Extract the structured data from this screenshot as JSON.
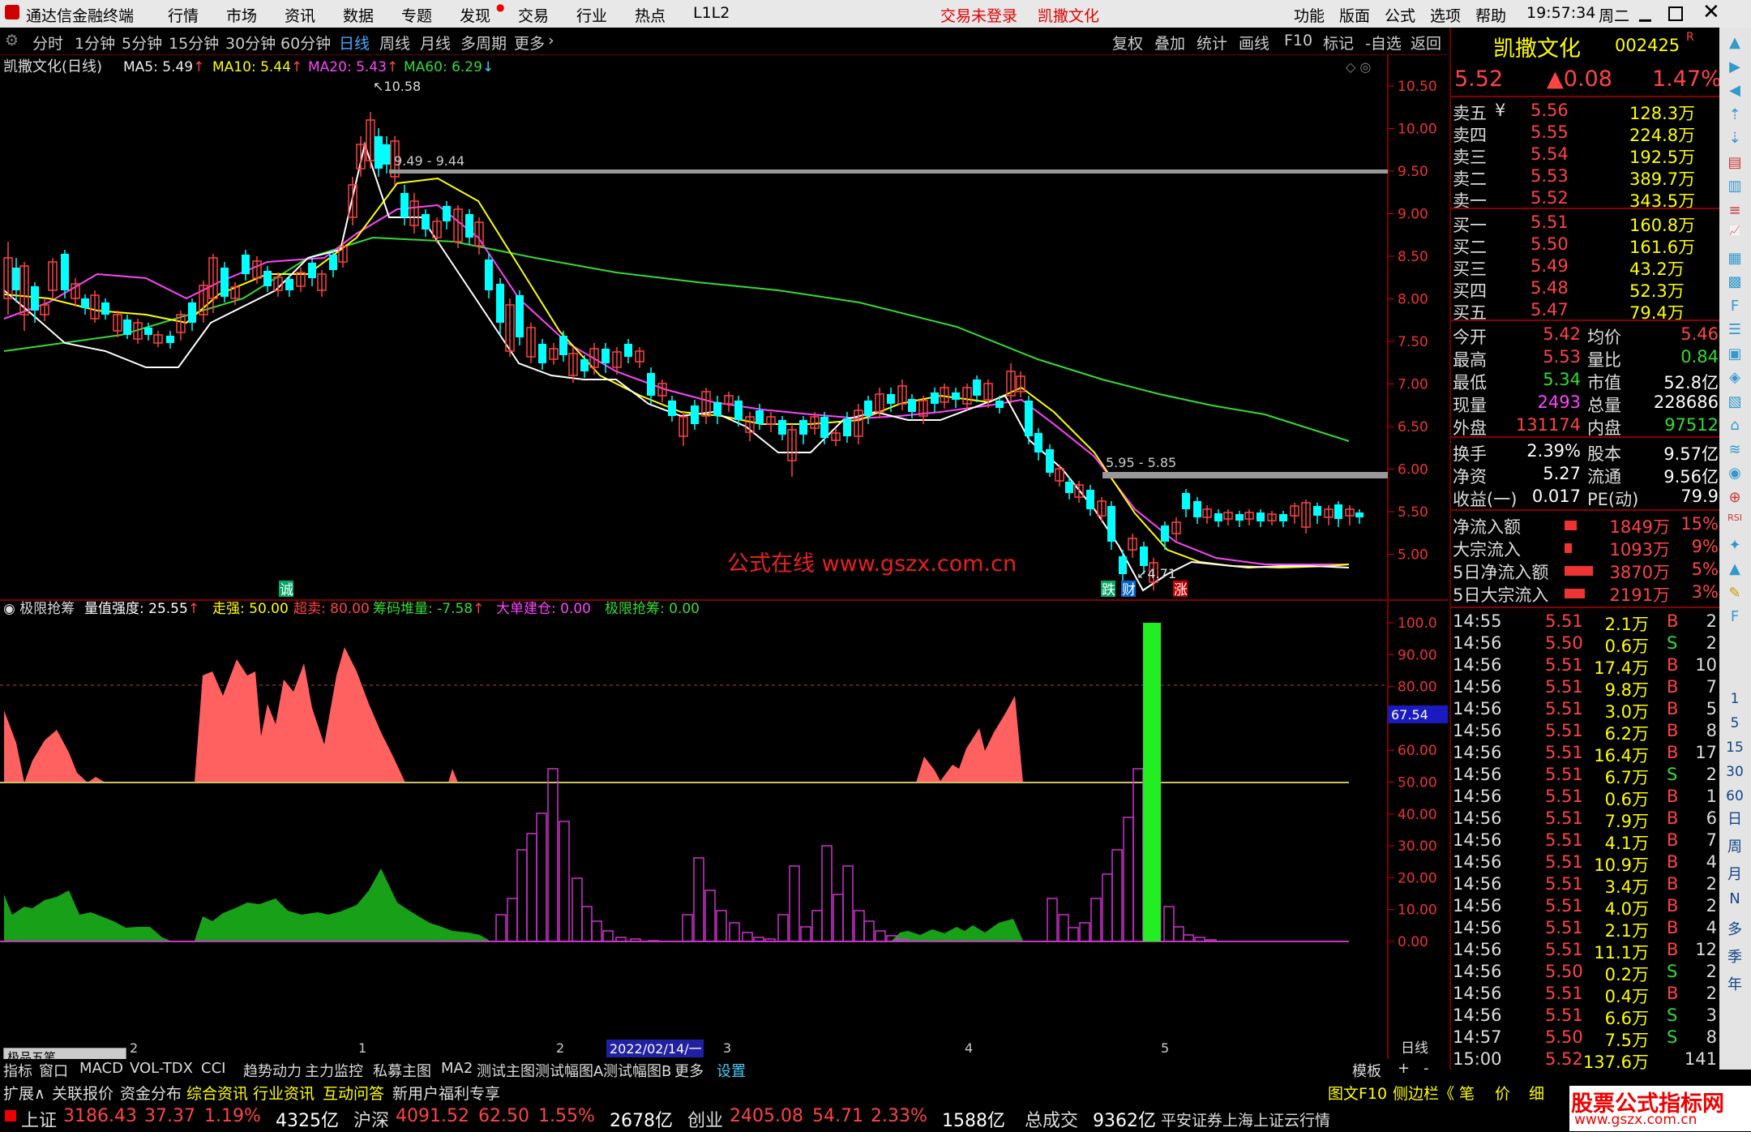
{
  "app": {
    "title": "通达信金融终端",
    "menu": [
      "行情",
      "市场",
      "资讯",
      "数据",
      "专题",
      "发现",
      "交易",
      "行业",
      "热点",
      "L1L2"
    ],
    "login_status": "交易未登录",
    "stock_name_top": "凯撒文化",
    "right_menu": [
      "功能",
      "版面",
      "公式",
      "选项",
      "帮助"
    ],
    "clock": "19:57:34",
    "weekday": "周二"
  },
  "period_bar": {
    "items": [
      "分时",
      "1分钟",
      "5分钟",
      "15分钟",
      "30分钟",
      "60分钟",
      "日线",
      "周线",
      "月线",
      "多周期",
      "更多"
    ],
    "selected": "日线",
    "tools": [
      "复权",
      "叠加",
      "统计",
      "画线",
      "F10",
      "标记",
      "-自选",
      "返回"
    ]
  },
  "main_chart": {
    "label": "凯撒文化(日线)",
    "ma": [
      {
        "name": "MA5",
        "value": "5.49",
        "arrow": "↑",
        "color": "#ffffff"
      },
      {
        "name": "MA10",
        "value": "5.44",
        "arrow": "↑",
        "color": "#ffff00"
      },
      {
        "name": "MA20",
        "value": "5.43",
        "arrow": "↑",
        "color": "#ff44ff"
      },
      {
        "name": "MA60",
        "value": "6.29",
        "arrow": "↓",
        "color": "#33dd33"
      }
    ],
    "y_ticks": [
      "10.50",
      "10.00",
      "9.50",
      "9.00",
      "8.50",
      "8.00",
      "7.50",
      "7.00",
      "6.50",
      "6.00",
      "5.50",
      "5.00"
    ],
    "annotations": {
      "high": "10.58",
      "low": "4.71",
      "band1": "9.49 - 9.44",
      "band2": "5.95 - 5.85"
    },
    "watermark": "公式在线  www.gszx.com.cn",
    "markers": [
      "诚",
      "跌",
      "财",
      "涨"
    ]
  },
  "indicator": {
    "name": "极限抢筹",
    "items": [
      {
        "label": "量值强度:",
        "value": "25.55",
        "arrow": "↑",
        "color": "#ffffff"
      },
      {
        "label": "走强:",
        "value": "50.00",
        "color": "#ffff00"
      },
      {
        "label": "超卖:",
        "value": "80.00",
        "color": "#ff4444"
      },
      {
        "label": "筹码堆量:",
        "value": "-7.58",
        "arrow": "↑",
        "color": "#33dd33"
      },
      {
        "label": "大单建仓:",
        "value": "0.00",
        "color": "#ff44ff"
      },
      {
        "label": "极限抢筹:",
        "value": "0.00",
        "color": "#33dd33"
      }
    ],
    "y_ticks": [
      "100.0",
      "90.00",
      "80.00",
      "70.00",
      "60.00",
      "50.00",
      "40.00",
      "30.00",
      "20.00",
      "10.00",
      "0.00"
    ],
    "current_value": "67.54"
  },
  "x_axis": {
    "labels": [
      "2",
      "1",
      "2",
      "3",
      "4",
      "5"
    ],
    "cursor_date": "2022/02/14/一",
    "period": "日线"
  },
  "quote": {
    "name": "凯撒文化",
    "code": "002425",
    "flag": "R",
    "price": "5.52",
    "change": "▲0.08",
    "pct": "1.47%",
    "asks": [
      {
        "label": "卖五",
        "mark": "¥",
        "price": "5.56",
        "vol": "128.3万"
      },
      {
        "label": "卖四",
        "price": "5.55",
        "vol": "224.8万"
      },
      {
        "label": "卖三",
        "price": "5.54",
        "vol": "192.5万"
      },
      {
        "label": "卖二",
        "price": "5.53",
        "vol": "389.7万"
      },
      {
        "label": "卖一",
        "price": "5.52",
        "vol": "343.5万"
      }
    ],
    "bids": [
      {
        "label": "买一",
        "price": "5.51",
        "vol": "160.8万"
      },
      {
        "label": "买二",
        "price": "5.50",
        "vol": "161.6万"
      },
      {
        "label": "买三",
        "price": "5.49",
        "vol": "43.2万"
      },
      {
        "label": "买四",
        "price": "5.48",
        "vol": "52.3万"
      },
      {
        "label": "买五",
        "price": "5.47",
        "vol": "79.4万"
      }
    ],
    "stats1": [
      {
        "l1": "今开",
        "v1": "5.42",
        "c1": "#ff4444",
        "l2": "均价",
        "v2": "5.46",
        "c2": "#ff4444"
      },
      {
        "l1": "最高",
        "v1": "5.53",
        "c1": "#ff4444",
        "l2": "量比",
        "v2": "0.84",
        "c2": "#33dd33"
      },
      {
        "l1": "最低",
        "v1": "5.34",
        "c1": "#33dd33",
        "l2": "市值",
        "v2": "52.8亿",
        "c2": "#ffffff"
      },
      {
        "l1": "现量",
        "v1": "2493",
        "c1": "#ff44ff",
        "l2": "总量",
        "v2": "228686",
        "c2": "#ffffff"
      },
      {
        "l1": "外盘",
        "v1": "131174",
        "c1": "#ff4444",
        "l2": "内盘",
        "v2": "97512",
        "c2": "#33dd33"
      }
    ],
    "stats2": [
      {
        "l1": "换手",
        "v1": "2.39%",
        "l2": "股本",
        "v2": "9.57亿"
      },
      {
        "l1": "净资",
        "v1": "5.27",
        "l2": "流通",
        "v2": "9.56亿"
      },
      {
        "l1": "收益(一)",
        "v1": "0.017",
        "l2": "PE(动)",
        "v2": "79.9"
      }
    ],
    "flows": [
      {
        "label": "净流入额",
        "value": "1849万",
        "pct": "15%",
        "bar": 0.15
      },
      {
        "label": "大宗流入",
        "value": "1093万",
        "pct": "9%",
        "bar": 0.09
      },
      {
        "label": "5日净流入额",
        "value": "3870万",
        "pct": "5%",
        "bar": 0.35
      },
      {
        "label": "5日大宗流入",
        "value": "2191万",
        "pct": "3%",
        "bar": 0.25
      }
    ],
    "ticks": [
      {
        "t": "14:55",
        "p": "5.51",
        "v": "2.1万",
        "s": "B",
        "n": "2"
      },
      {
        "t": "14:56",
        "p": "5.50",
        "v": "0.6万",
        "s": "S",
        "n": "2"
      },
      {
        "t": "14:56",
        "p": "5.51",
        "v": "17.4万",
        "s": "B",
        "n": "10"
      },
      {
        "t": "14:56",
        "p": "5.51",
        "v": "9.8万",
        "s": "B",
        "n": "7"
      },
      {
        "t": "14:56",
        "p": "5.51",
        "v": "3.0万",
        "s": "B",
        "n": "5"
      },
      {
        "t": "14:56",
        "p": "5.51",
        "v": "6.2万",
        "s": "B",
        "n": "8"
      },
      {
        "t": "14:56",
        "p": "5.51",
        "v": "16.4万",
        "s": "B",
        "n": "17"
      },
      {
        "t": "14:56",
        "p": "5.51",
        "v": "6.7万",
        "s": "S",
        "n": "2"
      },
      {
        "t": "14:56",
        "p": "5.51",
        "v": "0.6万",
        "s": "B",
        "n": "1"
      },
      {
        "t": "14:56",
        "p": "5.51",
        "v": "7.9万",
        "s": "B",
        "n": "6"
      },
      {
        "t": "14:56",
        "p": "5.51",
        "v": "4.1万",
        "s": "B",
        "n": "7"
      },
      {
        "t": "14:56",
        "p": "5.51",
        "v": "10.9万",
        "s": "B",
        "n": "4"
      },
      {
        "t": "14:56",
        "p": "5.51",
        "v": "3.4万",
        "s": "B",
        "n": "2"
      },
      {
        "t": "14:56",
        "p": "5.51",
        "v": "4.0万",
        "s": "B",
        "n": "2"
      },
      {
        "t": "14:56",
        "p": "5.51",
        "v": "2.1万",
        "s": "B",
        "n": "4"
      },
      {
        "t": "14:56",
        "p": "5.51",
        "v": "11.1万",
        "s": "B",
        "n": "12"
      },
      {
        "t": "14:56",
        "p": "5.50",
        "v": "0.2万",
        "s": "S",
        "n": "2"
      },
      {
        "t": "14:56",
        "p": "5.51",
        "v": "0.4万",
        "s": "B",
        "n": "2"
      },
      {
        "t": "14:56",
        "p": "5.51",
        "v": "6.6万",
        "s": "S",
        "n": "3"
      },
      {
        "t": "14:57",
        "p": "5.50",
        "v": "7.5万",
        "s": "S",
        "n": "8"
      },
      {
        "t": "15:00",
        "p": "5.52",
        "v": "137.6万",
        "s": "",
        "n": "141"
      }
    ]
  },
  "side_bar": {
    "labels": [
      "日",
      "周",
      "月",
      "N",
      "多",
      "季",
      "年"
    ],
    "numbers": [
      "1",
      "5",
      "15",
      "30",
      "60"
    ]
  },
  "indicator_tabs": [
    "指标",
    "窗口",
    "MACD",
    "VOL-TDX",
    "CCI",
    "趋势动力",
    "主力监控",
    "私募主图",
    "MA2",
    "测试主图",
    "测试幅图A",
    "测试幅图B",
    "更多",
    "设置"
  ],
  "indicator_tabs_right": [
    "模板",
    "+",
    "-"
  ],
  "small_panel": "极品五笔",
  "info_tabs": [
    "扩展∧",
    "关联报价",
    "资金分布",
    "综合资讯",
    "行业资讯",
    "互动问答",
    "新用户福利专享"
  ],
  "info_tabs_right": [
    "图文F10",
    "侧边栏《",
    "笔",
    "价",
    "细"
  ],
  "status": {
    "indices": [
      {
        "name": "上证",
        "value": "3186.43",
        "chg": "37.37",
        "pct": "1.19%",
        "amt": "4325亿"
      },
      {
        "name": "沪深",
        "value": "4091.52",
        "chg": "62.50",
        "pct": "1.55%",
        "amt": "2678亿"
      },
      {
        "name": "创业",
        "value": "2405.08",
        "chg": "54.71",
        "pct": "2.33%",
        "amt": "1588亿"
      }
    ],
    "total_label": "总成交",
    "total": "9362亿",
    "broker": "平安证券上海上证云行情",
    "logo": "股票公式指标网",
    "logo_url": "www.gszx.com.cn"
  },
  "colors": {
    "up": "#ff4444",
    "down": "#00ffff",
    "ma5": "#ffffff",
    "ma10": "#ffff00",
    "ma20": "#ff44ff",
    "ma60": "#33dd33",
    "grid": "#800000"
  }
}
